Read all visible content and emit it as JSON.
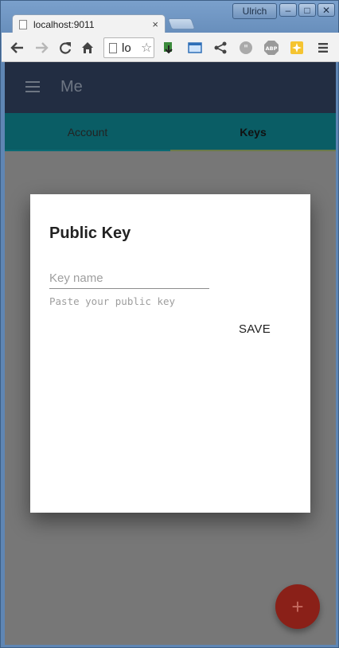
{
  "window": {
    "profile_name": "Ulrich",
    "controls": {
      "minimize": "–",
      "maximize": "□",
      "close": "✕"
    }
  },
  "browser": {
    "tab_title": "localhost:9011",
    "tab_close": "×",
    "url": "lo",
    "icons": {
      "back": "back-arrow-icon",
      "forward": "forward-arrow-icon",
      "reload": "reload-icon",
      "home": "home-icon",
      "bookmark": "star-icon",
      "menu": "hamburger-menu-icon"
    }
  },
  "app": {
    "title": "Me",
    "tabs": [
      {
        "label": "Account",
        "active": false
      },
      {
        "label": "Keys",
        "active": true
      }
    ],
    "fab_label": "+"
  },
  "dialog": {
    "title": "Public Key",
    "key_name_placeholder": "Key name",
    "key_name_value": "",
    "public_key_placeholder": "Paste your public key",
    "public_key_value": "",
    "save_label": "SAVE"
  },
  "colors": {
    "appbar": "#222d42",
    "tabsbar": "#0a5d65",
    "backdrop": "#777777",
    "fab": "#8a2018"
  }
}
